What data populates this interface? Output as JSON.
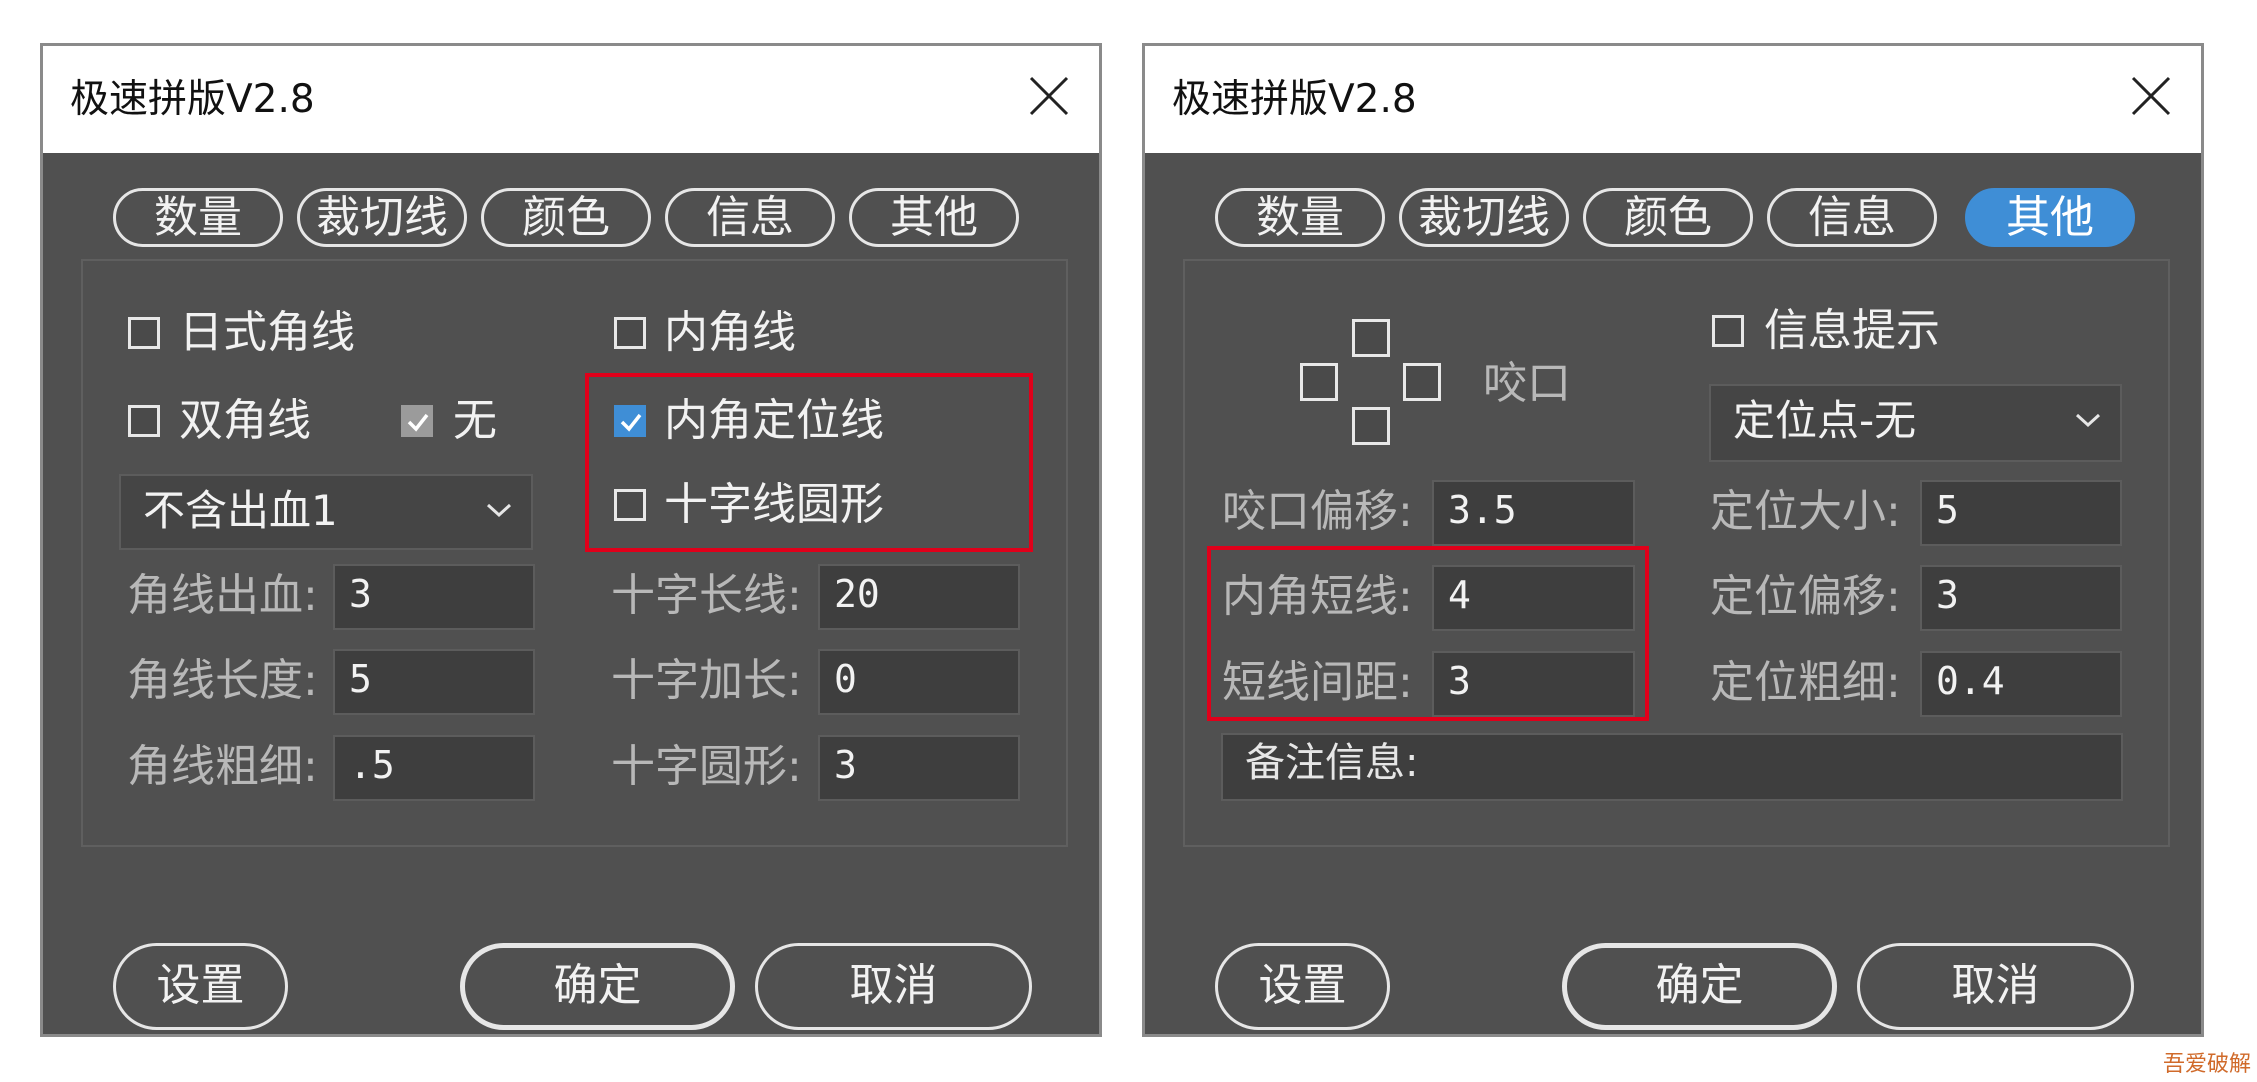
{
  "left": {
    "title": "极速拼版V2.8",
    "tabs": [
      "数量",
      "裁切线",
      "颜色",
      "信息",
      "其他"
    ],
    "checkboxes": {
      "japanese_corner": "日式角线",
      "double_corner": "双角线",
      "none": "无",
      "inner_corner": "内角线",
      "inner_corner_locator": "内角定位线",
      "cross_circle": "十字线圆形"
    },
    "bleed_select": "不含出血1",
    "fields": {
      "corner_bleed_label": "角线出血:",
      "corner_bleed_value": "3",
      "corner_length_label": "角线长度:",
      "corner_length_value": "5",
      "corner_thickness_label": "角线粗细:",
      "corner_thickness_value": ".5",
      "cross_long_label": "十字长线:",
      "cross_long_value": "20",
      "cross_extend_label": "十字加长:",
      "cross_extend_value": "0",
      "cross_circle_label": "十字圆形:",
      "cross_circle_value": "3"
    },
    "buttons": {
      "settings": "设置",
      "ok": "确定",
      "cancel": "取消"
    }
  },
  "right": {
    "title": "极速拼版V2.8",
    "tabs": [
      "数量",
      "裁切线",
      "颜色",
      "信息",
      "其他"
    ],
    "active_tab": "其他",
    "bite_label": "咬口",
    "info_hint": "信息提示",
    "locator_select": "定位点-无",
    "fields": {
      "bite_offset_label": "咬口偏移:",
      "bite_offset_value": "3.5",
      "inner_short_label": "内角短线:",
      "inner_short_value": "4",
      "short_spacing_label": "短线间距:",
      "short_spacing_value": "3",
      "loc_size_label": "定位大小:",
      "loc_size_value": "5",
      "loc_offset_label": "定位偏移:",
      "loc_offset_value": "3",
      "loc_thickness_label": "定位粗细:",
      "loc_thickness_value": "0.4",
      "note_placeholder": "备注信息:"
    },
    "buttons": {
      "settings": "设置",
      "ok": "确定",
      "cancel": "取消"
    }
  },
  "watermark": "吾爱破解",
  "colors": {
    "accent": "#3f8ed6",
    "highlight": "#e0001a",
    "dialog_bg": "#505050"
  }
}
